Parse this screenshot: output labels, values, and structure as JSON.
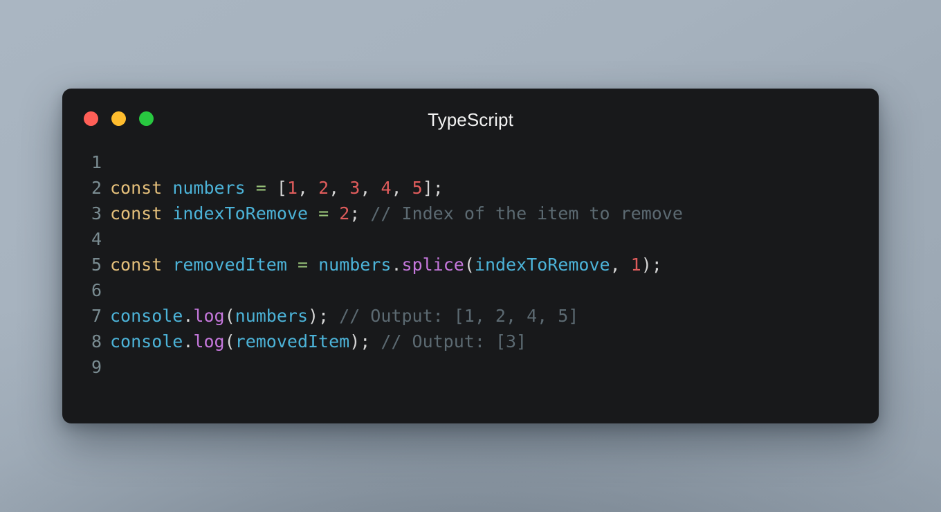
{
  "window": {
    "title": "TypeScript",
    "background_color": "#18191b",
    "traffic_lights": [
      {
        "name": "close",
        "color": "#ff5f57"
      },
      {
        "name": "minimize",
        "color": "#ffbd2e"
      },
      {
        "name": "maximize",
        "color": "#28c840"
      }
    ]
  },
  "page": {
    "backdrop_color": "#a7b3bf"
  },
  "editor": {
    "language": "TypeScript",
    "line_numbers": [
      "1",
      "2",
      "3",
      "4",
      "5",
      "6",
      "7",
      "8",
      "9"
    ],
    "lines": [
      {
        "number": "1",
        "tokens": []
      },
      {
        "number": "2",
        "tokens": [
          {
            "text": "const",
            "type": "keyword"
          },
          {
            "text": " ",
            "type": "plain"
          },
          {
            "text": "numbers",
            "type": "ident"
          },
          {
            "text": " ",
            "type": "plain"
          },
          {
            "text": "=",
            "type": "operator"
          },
          {
            "text": " ",
            "type": "plain"
          },
          {
            "text": "[",
            "type": "punct"
          },
          {
            "text": "1",
            "type": "number"
          },
          {
            "text": ", ",
            "type": "punct"
          },
          {
            "text": "2",
            "type": "number"
          },
          {
            "text": ", ",
            "type": "punct"
          },
          {
            "text": "3",
            "type": "number"
          },
          {
            "text": ", ",
            "type": "punct"
          },
          {
            "text": "4",
            "type": "number"
          },
          {
            "text": ", ",
            "type": "punct"
          },
          {
            "text": "5",
            "type": "number"
          },
          {
            "text": "];",
            "type": "punct"
          }
        ]
      },
      {
        "number": "3",
        "tokens": [
          {
            "text": "const",
            "type": "keyword"
          },
          {
            "text": " ",
            "type": "plain"
          },
          {
            "text": "indexToRemove",
            "type": "ident"
          },
          {
            "text": " ",
            "type": "plain"
          },
          {
            "text": "=",
            "type": "operator"
          },
          {
            "text": " ",
            "type": "plain"
          },
          {
            "text": "2",
            "type": "number"
          },
          {
            "text": "; ",
            "type": "punct"
          },
          {
            "text": "// Index of the item to remove",
            "type": "comment"
          }
        ]
      },
      {
        "number": "4",
        "tokens": []
      },
      {
        "number": "5",
        "tokens": [
          {
            "text": "const",
            "type": "keyword"
          },
          {
            "text": " ",
            "type": "plain"
          },
          {
            "text": "removedItem",
            "type": "ident"
          },
          {
            "text": " ",
            "type": "plain"
          },
          {
            "text": "=",
            "type": "operator"
          },
          {
            "text": " ",
            "type": "plain"
          },
          {
            "text": "numbers",
            "type": "ident"
          },
          {
            "text": ".",
            "type": "punct"
          },
          {
            "text": "splice",
            "type": "method"
          },
          {
            "text": "(",
            "type": "punct"
          },
          {
            "text": "indexToRemove",
            "type": "ident"
          },
          {
            "text": ", ",
            "type": "punct"
          },
          {
            "text": "1",
            "type": "number"
          },
          {
            "text": ");",
            "type": "punct"
          }
        ]
      },
      {
        "number": "6",
        "tokens": []
      },
      {
        "number": "7",
        "tokens": [
          {
            "text": "console",
            "type": "ident"
          },
          {
            "text": ".",
            "type": "punct"
          },
          {
            "text": "log",
            "type": "method"
          },
          {
            "text": "(",
            "type": "punct"
          },
          {
            "text": "numbers",
            "type": "ident"
          },
          {
            "text": "); ",
            "type": "punct"
          },
          {
            "text": "// Output: [1, 2, 4, 5]",
            "type": "comment"
          }
        ]
      },
      {
        "number": "8",
        "tokens": [
          {
            "text": "console",
            "type": "ident"
          },
          {
            "text": ".",
            "type": "punct"
          },
          {
            "text": "log",
            "type": "method"
          },
          {
            "text": "(",
            "type": "punct"
          },
          {
            "text": "removedItem",
            "type": "ident"
          },
          {
            "text": "); ",
            "type": "punct"
          },
          {
            "text": "// Output: [3]",
            "type": "comment"
          }
        ]
      },
      {
        "number": "9",
        "tokens": []
      }
    ],
    "syntax_colors": {
      "keyword": "#e5c07b",
      "identifier": "#4cb3d8",
      "operator": "#98c379",
      "number": "#e05c5c",
      "punctuation": "#d6d6d6",
      "method": "#c678dd",
      "comment": "#5c6a72",
      "line_number": "#7a8c92"
    }
  }
}
